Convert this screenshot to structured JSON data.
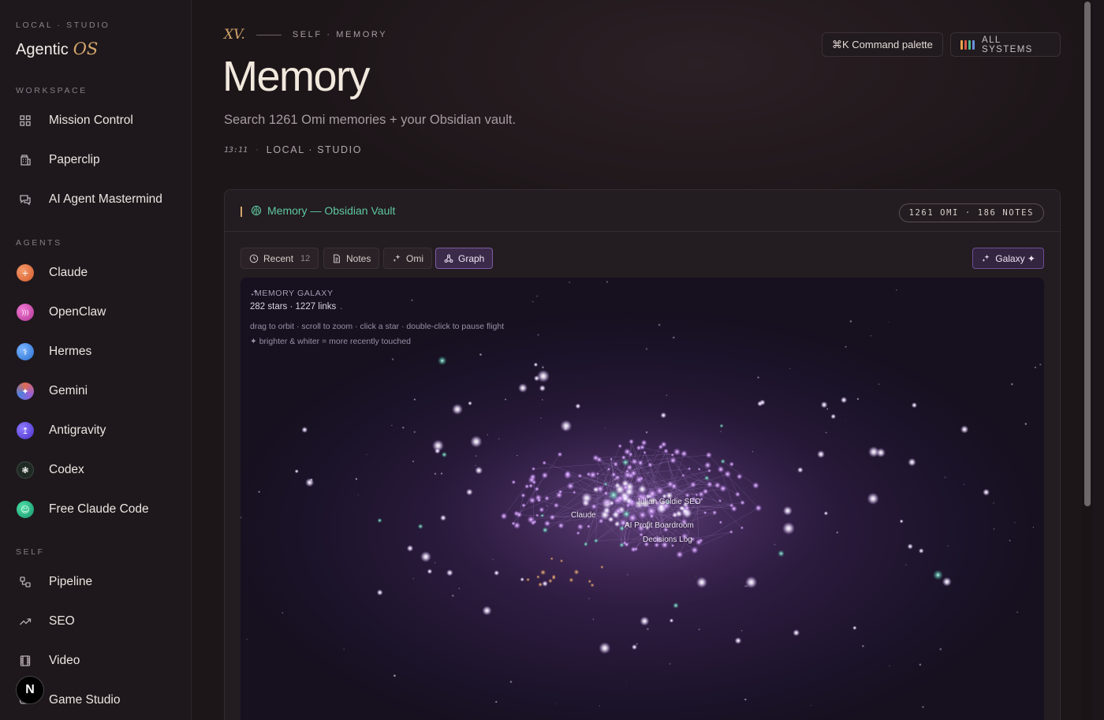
{
  "brand": {
    "kicker": "LOCAL · STUDIO",
    "name": "Agentic",
    "suffix": "OS"
  },
  "sidebar": {
    "workspace_label": "WORKSPACE",
    "workspace": [
      {
        "label": "Mission Control",
        "icon": "grid-icon"
      },
      {
        "label": "Paperclip",
        "icon": "building-icon"
      },
      {
        "label": "AI Agent Mastermind",
        "icon": "chat-icon"
      }
    ],
    "agents_label": "AGENTS",
    "agents": [
      {
        "label": "Claude",
        "glyph": "+",
        "color": "#e0703e"
      },
      {
        "label": "OpenClaw",
        "glyph": ")))",
        "color": "#d44fb4"
      },
      {
        "label": "Hermes",
        "glyph": "⚕",
        "color": "#3a84e0"
      },
      {
        "label": "Gemini",
        "glyph": "✦",
        "color": "#9b5fd6"
      },
      {
        "label": "Antigravity",
        "glyph": "↥",
        "color": "#5b3fd8"
      },
      {
        "label": "Codex",
        "glyph": "❃",
        "color": "#1f2a24"
      },
      {
        "label": "Free Claude Code",
        "glyph": "☺",
        "color": "#1fae7a"
      }
    ],
    "self_label": "SELF",
    "self": [
      {
        "label": "Pipeline",
        "icon": "pipeline-icon"
      },
      {
        "label": "SEO",
        "icon": "trend-icon"
      },
      {
        "label": "Video",
        "icon": "film-icon"
      },
      {
        "label": "Game Studio",
        "icon": "gamepad-icon"
      }
    ],
    "n_badge": "N"
  },
  "header": {
    "numeral": "XV.",
    "kicker": "SELF · MEMORY",
    "title": "Memory",
    "subtitle": "Search 1261 Omi memories + your Obsidian vault.",
    "time": "13:11",
    "location": "LOCAL · STUDIO",
    "command_palette": "⌘K  Command palette",
    "systems": "ALL SYSTEMS",
    "systems_colors": [
      "#e8a24a",
      "#d45b4b",
      "#4fb88c",
      "#6b8fe0"
    ]
  },
  "panel": {
    "title": "Memory — Obsidian Vault",
    "counts": "1261 OMI · 186 NOTES",
    "tabs": [
      {
        "label": "Recent",
        "count": "12"
      },
      {
        "label": "Notes"
      },
      {
        "label": "Omi"
      },
      {
        "label": "Graph"
      }
    ],
    "galaxy_button": "Galaxy ✦"
  },
  "galaxy": {
    "kicker": "MEMORY GALAXY",
    "stats": "282 stars · 1227 links",
    "help_line1": "drag to orbit · scroll to zoom · click a star · double-click to pause flight",
    "help_line2": "✦ brighter & whiter = more recently touched",
    "labels": [
      "Julian Goldie SEO",
      "Claude",
      "AI Profit Boardroom",
      "Decisions Log"
    ]
  }
}
